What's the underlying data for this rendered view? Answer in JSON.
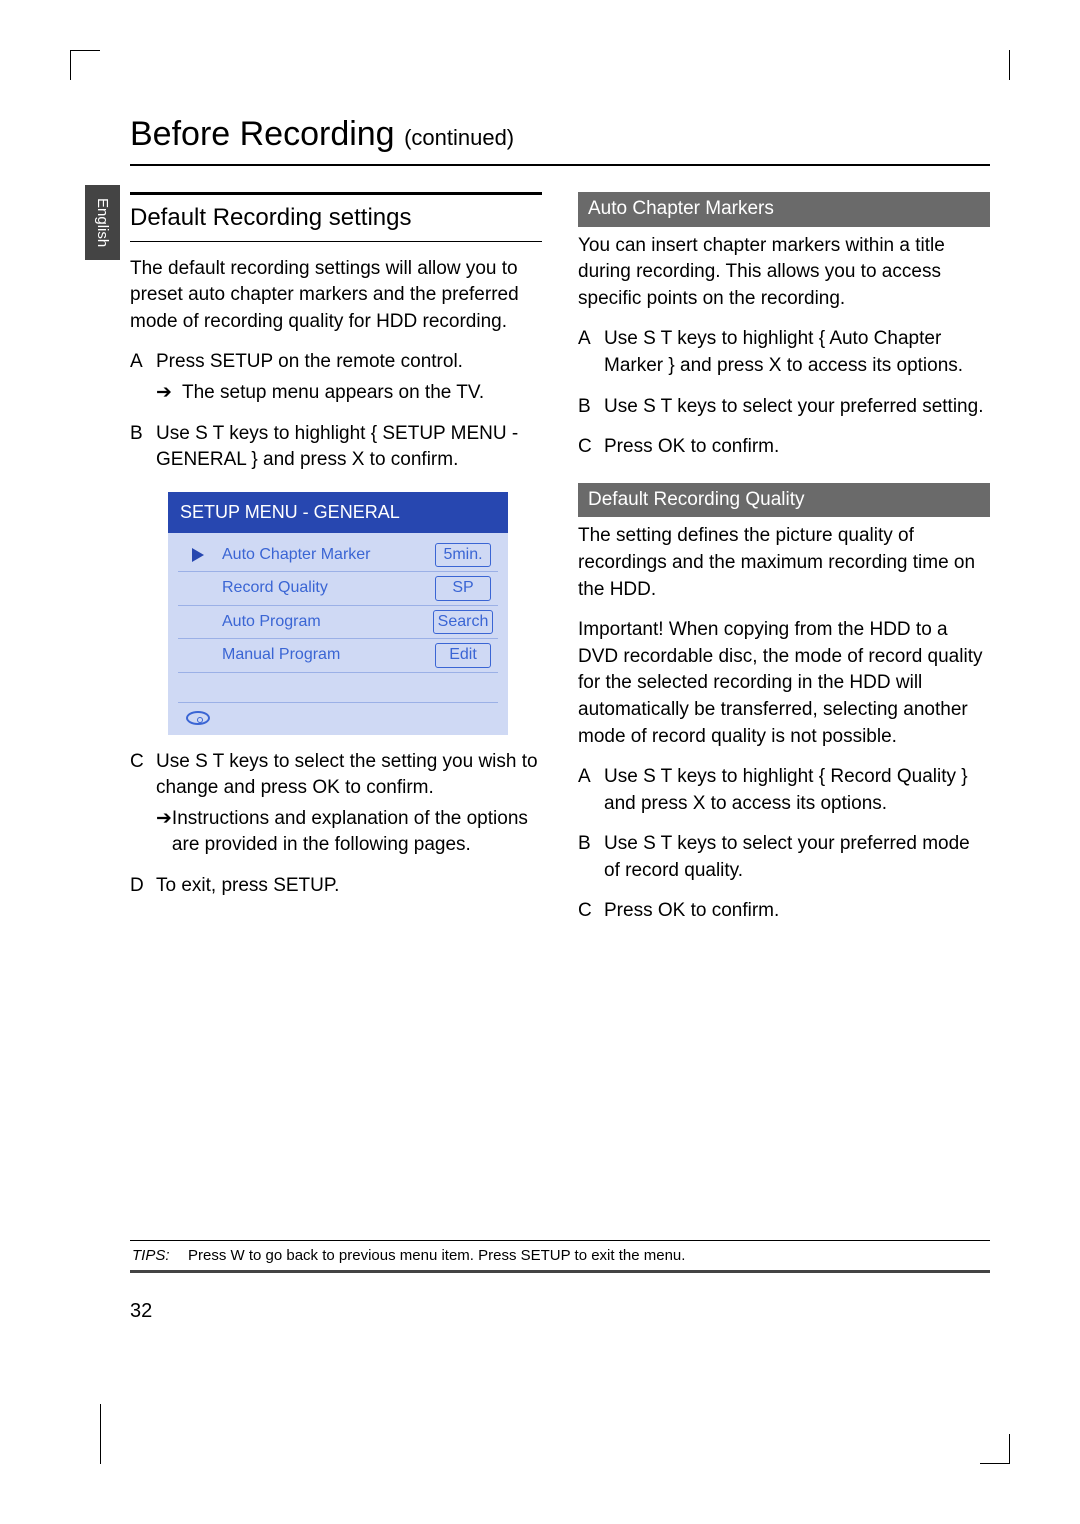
{
  "language_tab": "English",
  "header": {
    "title": "Before Recording",
    "continued": "(continued)"
  },
  "left": {
    "section_title": "Default Recording settings",
    "intro": "The default recording settings will allow you to preset auto chapter markers and the preferred mode of recording quality for HDD recording.",
    "steps": {
      "a": {
        "num": "A",
        "text": "Press SETUP on the remote control.",
        "arrow": "The setup menu appears on the TV."
      },
      "b": {
        "num": "B",
        "text": "Use S T keys to highlight { SETUP MENU - GENERAL } and press X to confirm."
      },
      "c": {
        "num": "C",
        "text": "Use S T keys to select the setting you wish to change and press OK to confirm.",
        "arrow": "Instructions and explanation of the options are provided in the following pages."
      },
      "d": {
        "num": "D",
        "text": "To exit, press SETUP."
      }
    },
    "menu": {
      "title": "SETUP MENU - GENERAL",
      "rows": [
        {
          "label": "Auto Chapter Marker",
          "value": "5min.",
          "icon": "play"
        },
        {
          "label": "Record Quality",
          "value": "SP",
          "icon": ""
        },
        {
          "label": "Auto Program",
          "value": "Search",
          "icon": ""
        },
        {
          "label": "Manual Program",
          "value": "Edit",
          "icon": ""
        }
      ]
    }
  },
  "right": {
    "auto": {
      "heading": "Auto Chapter Markers",
      "text": "You can insert chapter markers within a title during recording. This allows you to access specific points on the recording.",
      "a": {
        "num": "A",
        "text": "Use S T keys to highlight { Auto Chapter Marker } and press X to access its options."
      },
      "b": {
        "num": "B",
        "text": "Use S T keys to select your preferred setting."
      },
      "c": {
        "num": "C",
        "text": "Press OK to confirm."
      }
    },
    "quality": {
      "heading": "Default Recording Quality",
      "text1": "The setting defines the picture quality of recordings and the maximum recording time on the HDD.",
      "text2": "Important!  When copying from the HDD to a DVD recordable disc, the mode of record quality for the selected recording in the HDD will automatically be transferred, selecting another mode of record quality is not possible.",
      "a": {
        "num": "A",
        "text": "Use S T keys to highlight { Record Quality } and press X to access its options."
      },
      "b": {
        "num": "B",
        "text": "Use S T keys to select your preferred mode of record quality."
      },
      "c": {
        "num": "C",
        "text": "Press OK to confirm."
      }
    }
  },
  "tips": {
    "label": "TIPS:",
    "text": "Press W to go back to previous menu item. Press SETUP to exit the menu."
  },
  "page_number": "32"
}
